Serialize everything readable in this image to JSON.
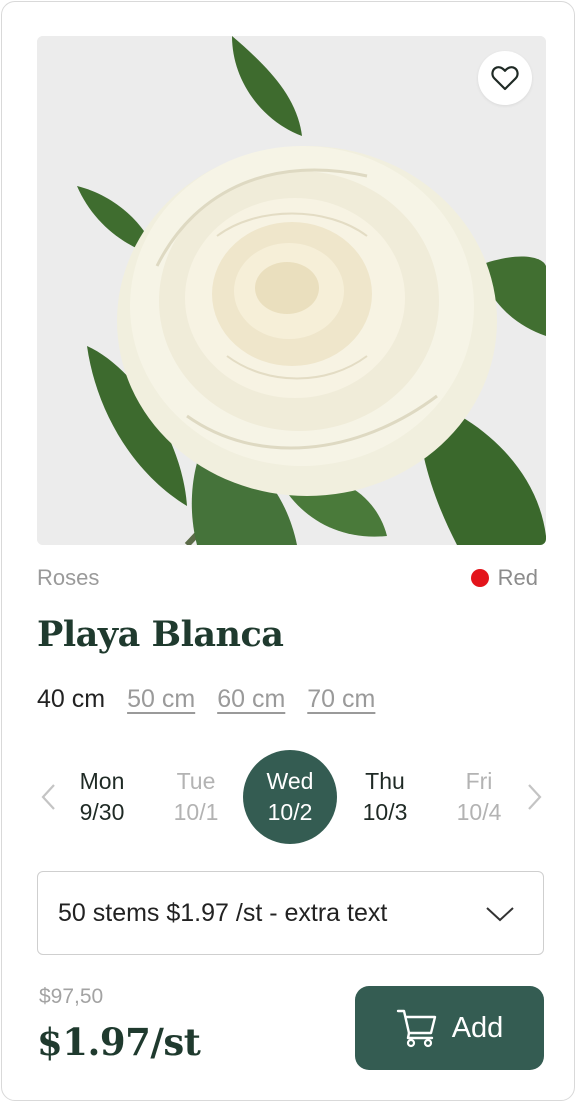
{
  "product": {
    "category": "Roses",
    "color_name": "Red",
    "color_hex": "#e3141b",
    "name": "Playa Blanca",
    "image_icon": "white-rose-image",
    "favorite_icon": "heart-icon"
  },
  "sizes": [
    {
      "label": "40 cm",
      "selected": true
    },
    {
      "label": "50 cm",
      "selected": false
    },
    {
      "label": "60 cm",
      "selected": false
    },
    {
      "label": "70 cm",
      "selected": false
    }
  ],
  "delivery_days": [
    {
      "day": "Mon",
      "date": "9/30",
      "state": "available"
    },
    {
      "day": "Tue",
      "date": "10/1",
      "state": "unavailable"
    },
    {
      "day": "Wed",
      "date": "10/2",
      "state": "selected"
    },
    {
      "day": "Thu",
      "date": "10/3",
      "state": "available"
    },
    {
      "day": "Fri",
      "date": "10/4",
      "state": "unavailable"
    }
  ],
  "quantity_select": {
    "value": "50 stems $1.97 /st - extra text"
  },
  "pricing": {
    "total": "$97,50",
    "per_stem": "$1.97/st"
  },
  "add_button": {
    "label": "Add",
    "icon": "cart-icon"
  },
  "colors": {
    "accent": "#345c52",
    "title": "#1f3a2e"
  }
}
